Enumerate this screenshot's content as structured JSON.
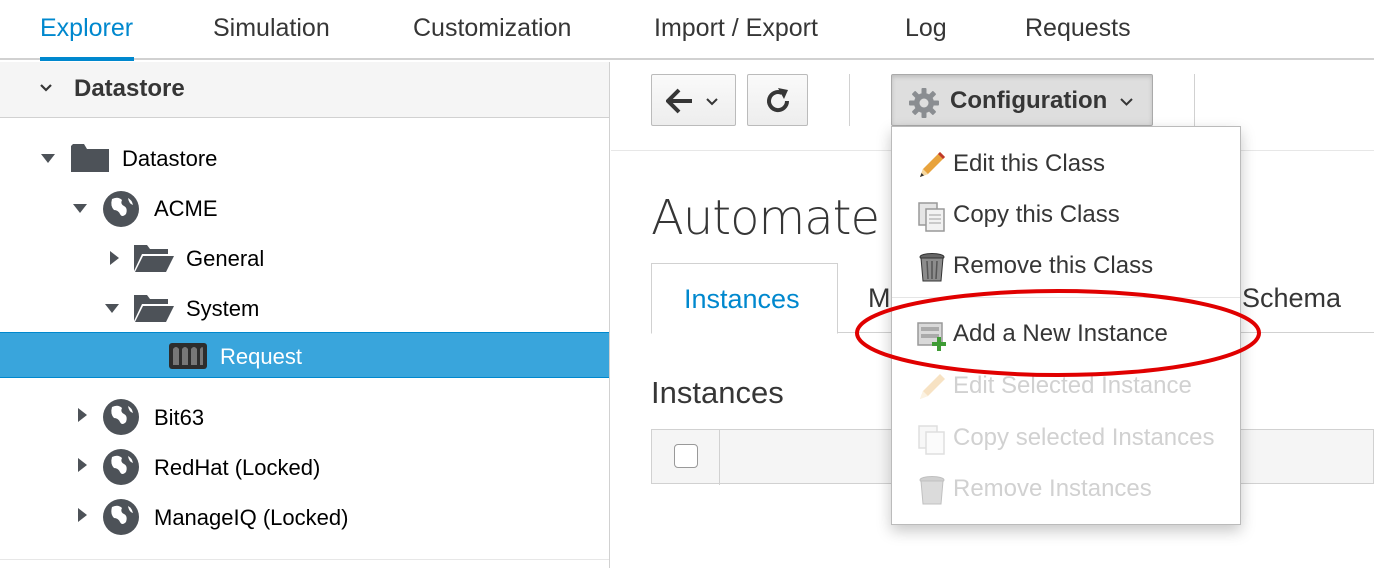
{
  "nav": {
    "tabs": [
      "Explorer",
      "Simulation",
      "Customization",
      "Import / Export",
      "Log",
      "Requests"
    ],
    "active": "Explorer"
  },
  "sidebar": {
    "accordion_title": "Datastore",
    "tree": [
      {
        "label": "Datastore",
        "icon": "folder-icon",
        "expanded": true
      },
      {
        "label": "ACME",
        "icon": "globe-icon",
        "expanded": true
      },
      {
        "label": "General",
        "icon": "folder-open-icon",
        "expanded": false
      },
      {
        "label": "System",
        "icon": "folder-open-icon",
        "expanded": true
      },
      {
        "label": "Request",
        "icon": "class-icon",
        "selected": true
      },
      {
        "label": "Bit63",
        "icon": "globe-icon",
        "expanded": false
      },
      {
        "label": "RedHat (Locked)",
        "icon": "globe-icon",
        "expanded": false
      },
      {
        "label": "ManageIQ (Locked)",
        "icon": "globe-icon",
        "expanded": false
      }
    ]
  },
  "toolbar": {
    "back_icon": "arrow-left-icon",
    "reload_icon": "reload-icon",
    "configuration_label": "Configuration"
  },
  "main": {
    "title": "Automate C",
    "tabs": [
      "Instances",
      "M",
      "Schema"
    ],
    "active_tab": "Instances",
    "section_title": "Instances"
  },
  "dropdown": {
    "items": [
      {
        "label": "Edit this Class",
        "icon": "pencil-icon",
        "enabled": true
      },
      {
        "label": "Copy this Class",
        "icon": "copy-icon",
        "enabled": true
      },
      {
        "label": "Remove this Class",
        "icon": "trash-icon",
        "enabled": true
      },
      {
        "label": "Add a New Instance",
        "icon": "add-instance-icon",
        "enabled": true
      },
      {
        "label": "Edit Selected Instance",
        "icon": "pencil-icon",
        "enabled": false
      },
      {
        "label": "Copy selected Instances",
        "icon": "copy-icon",
        "enabled": false
      },
      {
        "label": "Remove Instances",
        "icon": "trash-icon",
        "enabled": false
      }
    ]
  },
  "colors": {
    "accent": "#0088ce",
    "selected_row": "#39a5dc",
    "highlight": "#e00000"
  }
}
